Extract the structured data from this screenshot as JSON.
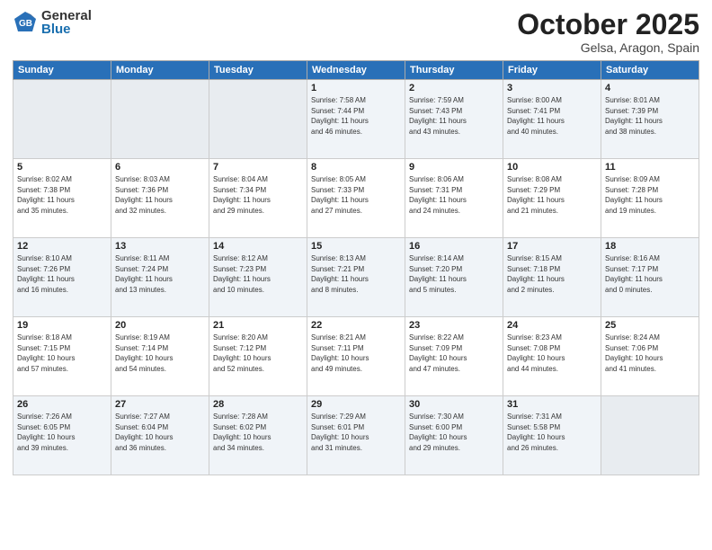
{
  "header": {
    "logo_general": "General",
    "logo_blue": "Blue",
    "month": "October 2025",
    "location": "Gelsa, Aragon, Spain"
  },
  "weekdays": [
    "Sunday",
    "Monday",
    "Tuesday",
    "Wednesday",
    "Thursday",
    "Friday",
    "Saturday"
  ],
  "weeks": [
    [
      {
        "day": "",
        "text": ""
      },
      {
        "day": "",
        "text": ""
      },
      {
        "day": "",
        "text": ""
      },
      {
        "day": "1",
        "text": "Sunrise: 7:58 AM\nSunset: 7:44 PM\nDaylight: 11 hours\nand 46 minutes."
      },
      {
        "day": "2",
        "text": "Sunrise: 7:59 AM\nSunset: 7:43 PM\nDaylight: 11 hours\nand 43 minutes."
      },
      {
        "day": "3",
        "text": "Sunrise: 8:00 AM\nSunset: 7:41 PM\nDaylight: 11 hours\nand 40 minutes."
      },
      {
        "day": "4",
        "text": "Sunrise: 8:01 AM\nSunset: 7:39 PM\nDaylight: 11 hours\nand 38 minutes."
      }
    ],
    [
      {
        "day": "5",
        "text": "Sunrise: 8:02 AM\nSunset: 7:38 PM\nDaylight: 11 hours\nand 35 minutes."
      },
      {
        "day": "6",
        "text": "Sunrise: 8:03 AM\nSunset: 7:36 PM\nDaylight: 11 hours\nand 32 minutes."
      },
      {
        "day": "7",
        "text": "Sunrise: 8:04 AM\nSunset: 7:34 PM\nDaylight: 11 hours\nand 29 minutes."
      },
      {
        "day": "8",
        "text": "Sunrise: 8:05 AM\nSunset: 7:33 PM\nDaylight: 11 hours\nand 27 minutes."
      },
      {
        "day": "9",
        "text": "Sunrise: 8:06 AM\nSunset: 7:31 PM\nDaylight: 11 hours\nand 24 minutes."
      },
      {
        "day": "10",
        "text": "Sunrise: 8:08 AM\nSunset: 7:29 PM\nDaylight: 11 hours\nand 21 minutes."
      },
      {
        "day": "11",
        "text": "Sunrise: 8:09 AM\nSunset: 7:28 PM\nDaylight: 11 hours\nand 19 minutes."
      }
    ],
    [
      {
        "day": "12",
        "text": "Sunrise: 8:10 AM\nSunset: 7:26 PM\nDaylight: 11 hours\nand 16 minutes."
      },
      {
        "day": "13",
        "text": "Sunrise: 8:11 AM\nSunset: 7:24 PM\nDaylight: 11 hours\nand 13 minutes."
      },
      {
        "day": "14",
        "text": "Sunrise: 8:12 AM\nSunset: 7:23 PM\nDaylight: 11 hours\nand 10 minutes."
      },
      {
        "day": "15",
        "text": "Sunrise: 8:13 AM\nSunset: 7:21 PM\nDaylight: 11 hours\nand 8 minutes."
      },
      {
        "day": "16",
        "text": "Sunrise: 8:14 AM\nSunset: 7:20 PM\nDaylight: 11 hours\nand 5 minutes."
      },
      {
        "day": "17",
        "text": "Sunrise: 8:15 AM\nSunset: 7:18 PM\nDaylight: 11 hours\nand 2 minutes."
      },
      {
        "day": "18",
        "text": "Sunrise: 8:16 AM\nSunset: 7:17 PM\nDaylight: 11 hours\nand 0 minutes."
      }
    ],
    [
      {
        "day": "19",
        "text": "Sunrise: 8:18 AM\nSunset: 7:15 PM\nDaylight: 10 hours\nand 57 minutes."
      },
      {
        "day": "20",
        "text": "Sunrise: 8:19 AM\nSunset: 7:14 PM\nDaylight: 10 hours\nand 54 minutes."
      },
      {
        "day": "21",
        "text": "Sunrise: 8:20 AM\nSunset: 7:12 PM\nDaylight: 10 hours\nand 52 minutes."
      },
      {
        "day": "22",
        "text": "Sunrise: 8:21 AM\nSunset: 7:11 PM\nDaylight: 10 hours\nand 49 minutes."
      },
      {
        "day": "23",
        "text": "Sunrise: 8:22 AM\nSunset: 7:09 PM\nDaylight: 10 hours\nand 47 minutes."
      },
      {
        "day": "24",
        "text": "Sunrise: 8:23 AM\nSunset: 7:08 PM\nDaylight: 10 hours\nand 44 minutes."
      },
      {
        "day": "25",
        "text": "Sunrise: 8:24 AM\nSunset: 7:06 PM\nDaylight: 10 hours\nand 41 minutes."
      }
    ],
    [
      {
        "day": "26",
        "text": "Sunrise: 7:26 AM\nSunset: 6:05 PM\nDaylight: 10 hours\nand 39 minutes."
      },
      {
        "day": "27",
        "text": "Sunrise: 7:27 AM\nSunset: 6:04 PM\nDaylight: 10 hours\nand 36 minutes."
      },
      {
        "day": "28",
        "text": "Sunrise: 7:28 AM\nSunset: 6:02 PM\nDaylight: 10 hours\nand 34 minutes."
      },
      {
        "day": "29",
        "text": "Sunrise: 7:29 AM\nSunset: 6:01 PM\nDaylight: 10 hours\nand 31 minutes."
      },
      {
        "day": "30",
        "text": "Sunrise: 7:30 AM\nSunset: 6:00 PM\nDaylight: 10 hours\nand 29 minutes."
      },
      {
        "day": "31",
        "text": "Sunrise: 7:31 AM\nSunset: 5:58 PM\nDaylight: 10 hours\nand 26 minutes."
      },
      {
        "day": "",
        "text": ""
      }
    ]
  ]
}
